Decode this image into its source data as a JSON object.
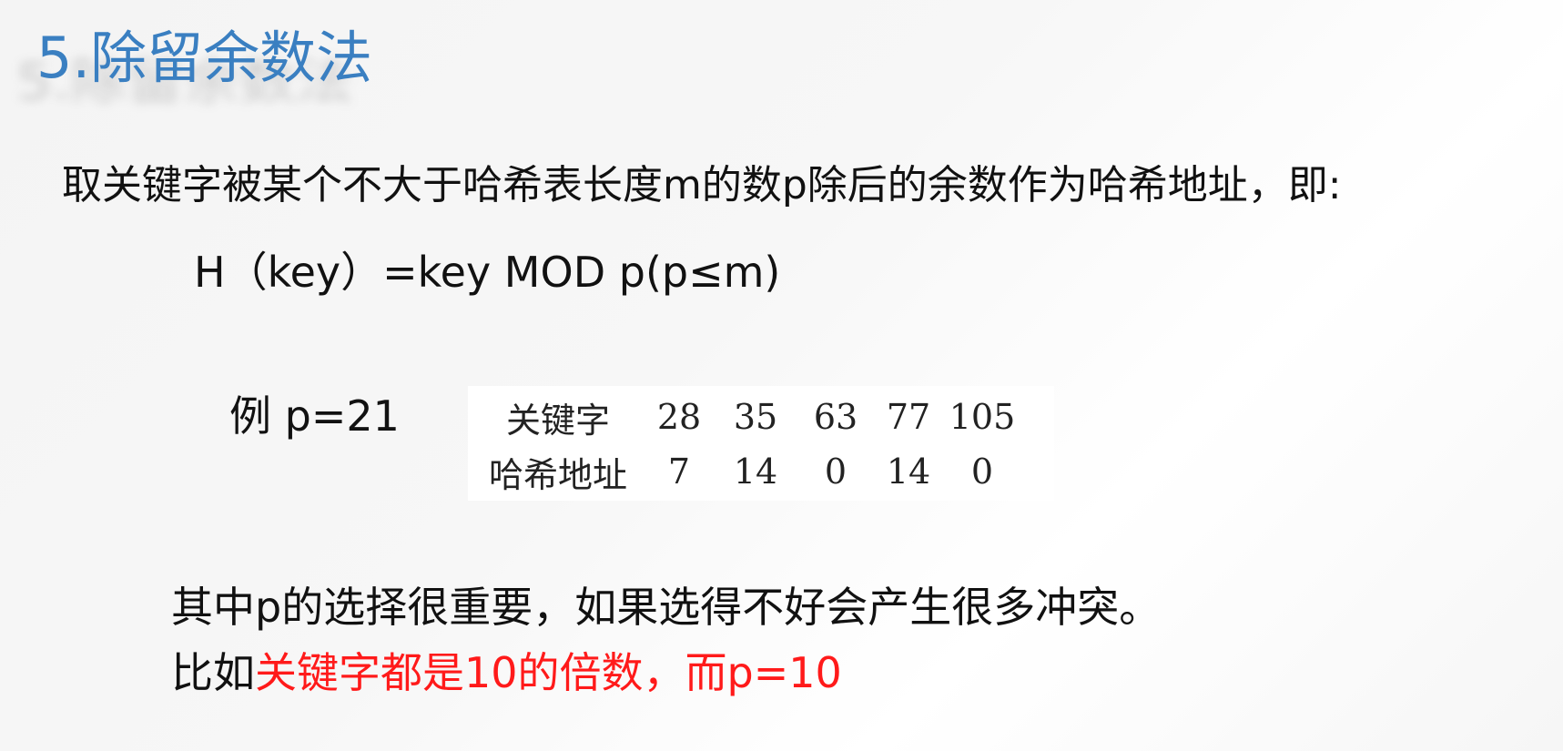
{
  "slide": {
    "title": "5.除留余数法",
    "definition": "取关键字被某个不大于哈希表长度m的数p除后的余数作为哈希地址，即:",
    "formula": "H（key）=key MOD p(p≤m)",
    "example_label": "例 p=21",
    "example_table": {
      "rows": [
        {
          "header": "关键字",
          "values": [
            "28",
            "35",
            "63",
            "77",
            "105"
          ]
        },
        {
          "header": "哈希地址",
          "values": [
            "7",
            "14",
            "0",
            "14",
            "0"
          ]
        }
      ]
    },
    "note_line1": "其中p的选择很重要，如果选得不好会产生很多冲突。",
    "note_line2_prefix": "比如",
    "note_line2_highlight": "关键字都是10的倍数，而p=10",
    "colors": {
      "title": "#3a7fc1",
      "highlight": "#ff1a1a",
      "text": "#111111"
    }
  }
}
